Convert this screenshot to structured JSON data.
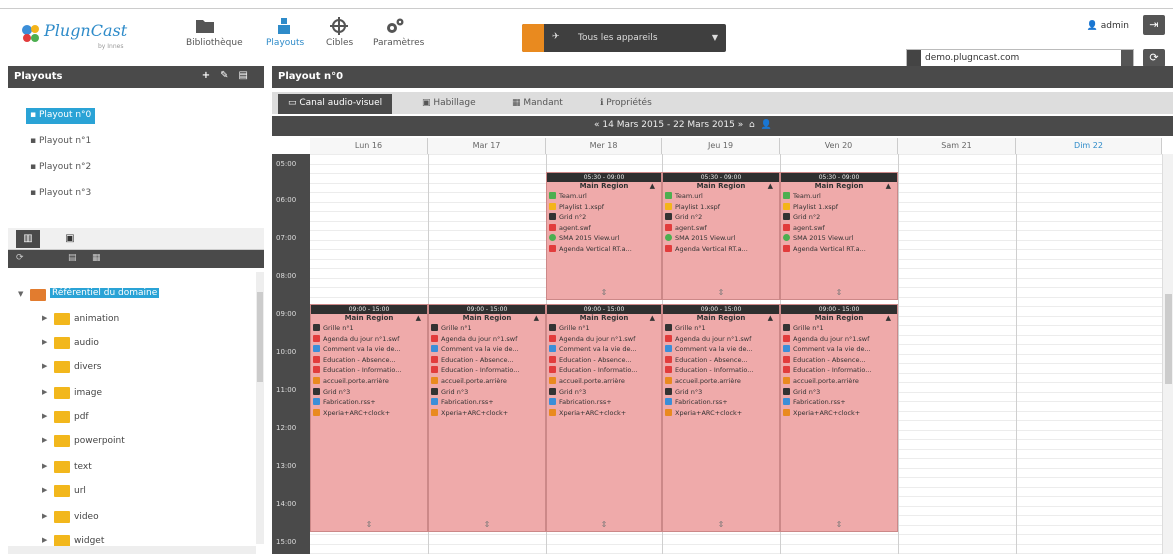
{
  "header": {
    "logo_text": "PlugnCast",
    "logo_sub": "by Innes",
    "nav": [
      {
        "label": "Bibliothèque",
        "icon": "folder-icon"
      },
      {
        "label": "Playouts",
        "icon": "playouts-icon"
      },
      {
        "label": "Cibles",
        "icon": "target-icon"
      },
      {
        "label": "Paramètres",
        "icon": "gears-icon"
      }
    ],
    "device_selector": "Tous les appareils",
    "user": "admin",
    "url": "demo.plugncast.com"
  },
  "left": {
    "title": "Playouts",
    "playouts": [
      "Playout n°0",
      "Playout n°1",
      "Playout n°2",
      "Playout n°3"
    ],
    "tree_root": "Référentiel du domaine",
    "folders": [
      "animation",
      "audio",
      "divers",
      "image",
      "pdf",
      "powerpoint",
      "text",
      "url",
      "video",
      "widget"
    ]
  },
  "right": {
    "title": "Playout n°0",
    "tabs": [
      "Canal audio-visuel",
      "Habillage",
      "Mandant",
      "Propriétés"
    ],
    "week_range": "14 Mars 2015 - 22 Mars 2015",
    "days": [
      "Lun 16",
      "Mar 17",
      "Mer 18",
      "Jeu 19",
      "Ven 20",
      "Sam 21",
      "Dim 22"
    ],
    "hours": [
      "05:00",
      "06:00",
      "07:00",
      "08:00",
      "09:00",
      "10:00",
      "11:00",
      "12:00",
      "13:00",
      "14:00",
      "15:00"
    ]
  },
  "events": {
    "morning": {
      "time": "05:30 - 09:00",
      "region": "Main Region",
      "items": [
        "Team.url",
        "Playlist 1.xspf",
        "Grid n°2",
        "agent.swf",
        "SMA 2015 View.url",
        "Agenda Vertical RT.a..."
      ]
    },
    "late": {
      "time": "09:00 - 15:00",
      "region": "Main Region",
      "items": [
        "Grille n°1",
        "Agenda du jour n°1.swf",
        "Comment va la vie de...",
        "Education - Absence...",
        "Education - Informatio...",
        "accueil.porte.arrière",
        "Grid n°3",
        "Fabrication.rss+",
        "Xperia+ARC+clock+"
      ]
    }
  },
  "colors": {
    "accent": "#2aa3d6",
    "event_bg": "#efaaaa",
    "dark_bar": "#4a4a4a",
    "orange": "#e98a1f"
  }
}
